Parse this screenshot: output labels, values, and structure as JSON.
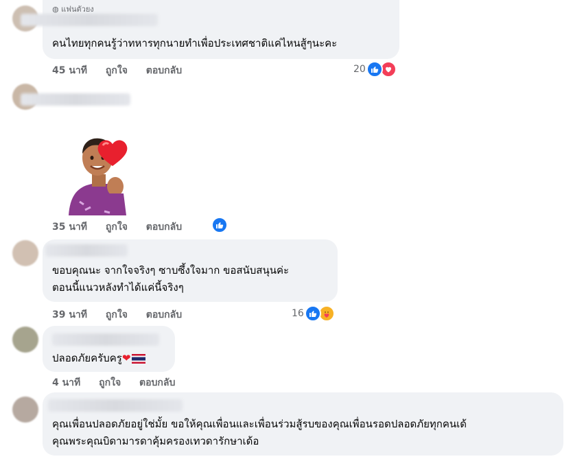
{
  "comments": [
    {
      "badge": "แฟนตัวยง",
      "text_lines": [
        "คนไทยทุกคนรู้ว่าทหารทุกนายทำเพื่อประเทศชาติแค่ไหนสู้ๆนะคะ"
      ],
      "time": "45 นาที",
      "like_label": "ถูกใจ",
      "reply_label": "ตอบกลับ",
      "reaction_count": "20",
      "reactions": [
        "like-icon",
        "love-icon"
      ]
    },
    {
      "sticker": "finger-heart-sticker",
      "time": "35 นาที",
      "like_label": "ถูกใจ",
      "reply_label": "ตอบกลับ",
      "reactions": [
        "like-icon"
      ]
    },
    {
      "text_lines": [
        "ขอบคุณนะ จากใจจริงๆ ซาบซึ้งใจมาก ขอสนับสนุนค่ะ",
        "ตอนนี้แนวหลังทำได้แค่นี้จริงๆ"
      ],
      "time": "39 นาที",
      "like_label": "ถูกใจ",
      "reply_label": "ตอบกลับ",
      "reaction_count": "16",
      "reactions": [
        "like-icon",
        "care-icon"
      ]
    },
    {
      "text_lines": [
        "ปลอดภัยครับครู"
      ],
      "time": "4 นาที",
      "like_label": "ถูกใจ",
      "reply_label": "ตอบกลับ",
      "emoji": [
        "red-heart-emoji",
        "thai-flag-emoji"
      ]
    },
    {
      "text_lines": [
        "คุณเพื่อนปลอดภัยอยู่ใช่มั้ย ขอให้คุณเพื่อนและเพื่อนร่วมสู้รบของคุณเพื่อนรอดปลอดภัยทุกคนเด้",
        "คุณพระคุณบิดามารดาคุ้มครองเทวดารักษาเด้อ"
      ]
    }
  ],
  "colors": {
    "bubble": "#f0f2f5",
    "meta_text": "#65676b",
    "like_blue": "#1877f2",
    "love_red": "#f33e58"
  }
}
